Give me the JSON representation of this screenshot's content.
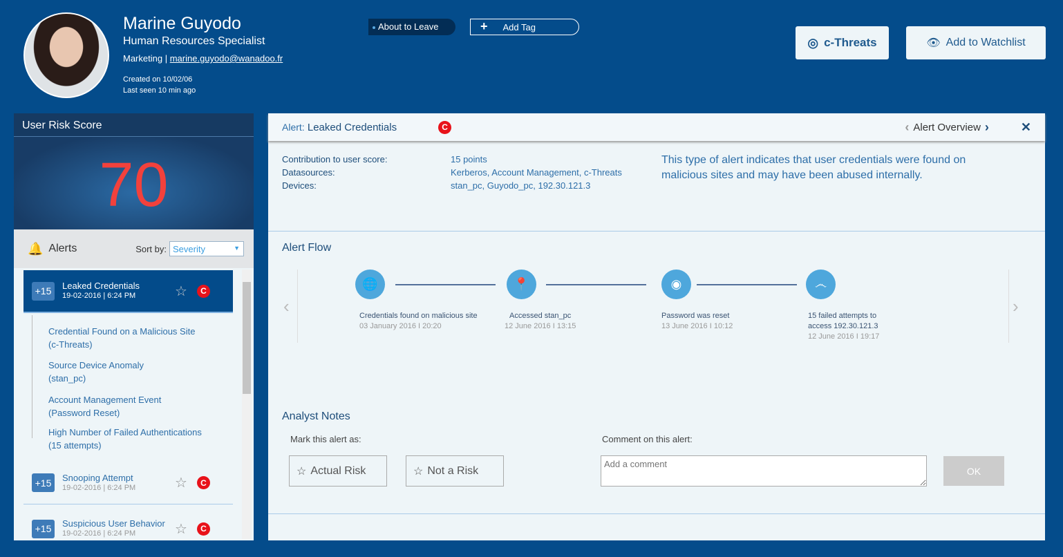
{
  "user": {
    "name": "Marine Guyodo",
    "title": "Human Resources Specialist",
    "department": "Marketing",
    "separator": "|",
    "email": "marine.guyodo@wanadoo.fr",
    "created": "Created on 10/02/06",
    "last_seen": "Last seen 10 min ago"
  },
  "tags": {
    "status": "About to Leave",
    "add_tag": "Add Tag"
  },
  "actions": {
    "cthreats": "c-Threats",
    "watchlist": "Add to Watchlist"
  },
  "risk": {
    "title": "User Risk Score",
    "score": "70"
  },
  "alerts": {
    "title": "Alerts",
    "sort_label": "Sort by:",
    "sort_value": "Severity",
    "items": [
      {
        "points": "+15",
        "name": "Leaked Credentials",
        "date": "19-02-2016 | 6:24 PM",
        "severity": "C"
      },
      {
        "points": "+15",
        "name": "Snooping Attempt",
        "date": "19-02-2016 | 6:24 PM",
        "severity": "C"
      },
      {
        "points": "+15",
        "name": "Suspicious User Behavior",
        "date": "19-02-2016 | 6:24 PM",
        "severity": "C"
      }
    ],
    "sub_items": [
      {
        "line1": "Credential Found on a Malicious Site",
        "line2": "(c-Threats)"
      },
      {
        "line1": "Source Device Anomaly",
        "line2": "(stan_pc)"
      },
      {
        "line1": "Account Management Event",
        "line2": "(Password Reset)"
      },
      {
        "line1": "High Number of Failed Authentications",
        "line2": "(15 attempts)"
      }
    ]
  },
  "alert": {
    "prefix": "Alert:",
    "name": "Leaked Credentials",
    "severity": "C",
    "nav_label": "Alert Overview",
    "contribution_label": "Contribution to user score:",
    "contribution": "15 points",
    "datasources_label": "Datasources:",
    "datasources": "Kerberos, Account Management, c-Threats",
    "devices_label": "Devices:",
    "devices": "stan_pc, Guyodo_pc, 192.30.121.3",
    "description": "This type of alert indicates that user credentials were found on malicious sites and may have been abused internally."
  },
  "flow": {
    "title": "Alert Flow",
    "steps": [
      {
        "icon": "globe-icon",
        "label": "Credentials found on malicious site",
        "date": "03 January 2016  I 20:20"
      },
      {
        "icon": "location-pin-icon",
        "label": "Accessed stan_pc",
        "date": "12 June 2016  I 13:15"
      },
      {
        "icon": "signal-icon",
        "label": "Password was reset",
        "date": "13 June 2016  I 10:12"
      },
      {
        "icon": "fingerprint-icon",
        "label": "15 failed attempts to access 192.30.121.3",
        "date": "12 June 2016  I 19:17"
      }
    ]
  },
  "notes": {
    "title": "Analyst Notes",
    "mark_label": "Mark this alert as:",
    "actual_risk": "Actual Risk",
    "not_risk": "Not a Risk",
    "comment_label": "Comment on this alert:",
    "comment_placeholder": "Add a comment",
    "ok": "OK"
  }
}
